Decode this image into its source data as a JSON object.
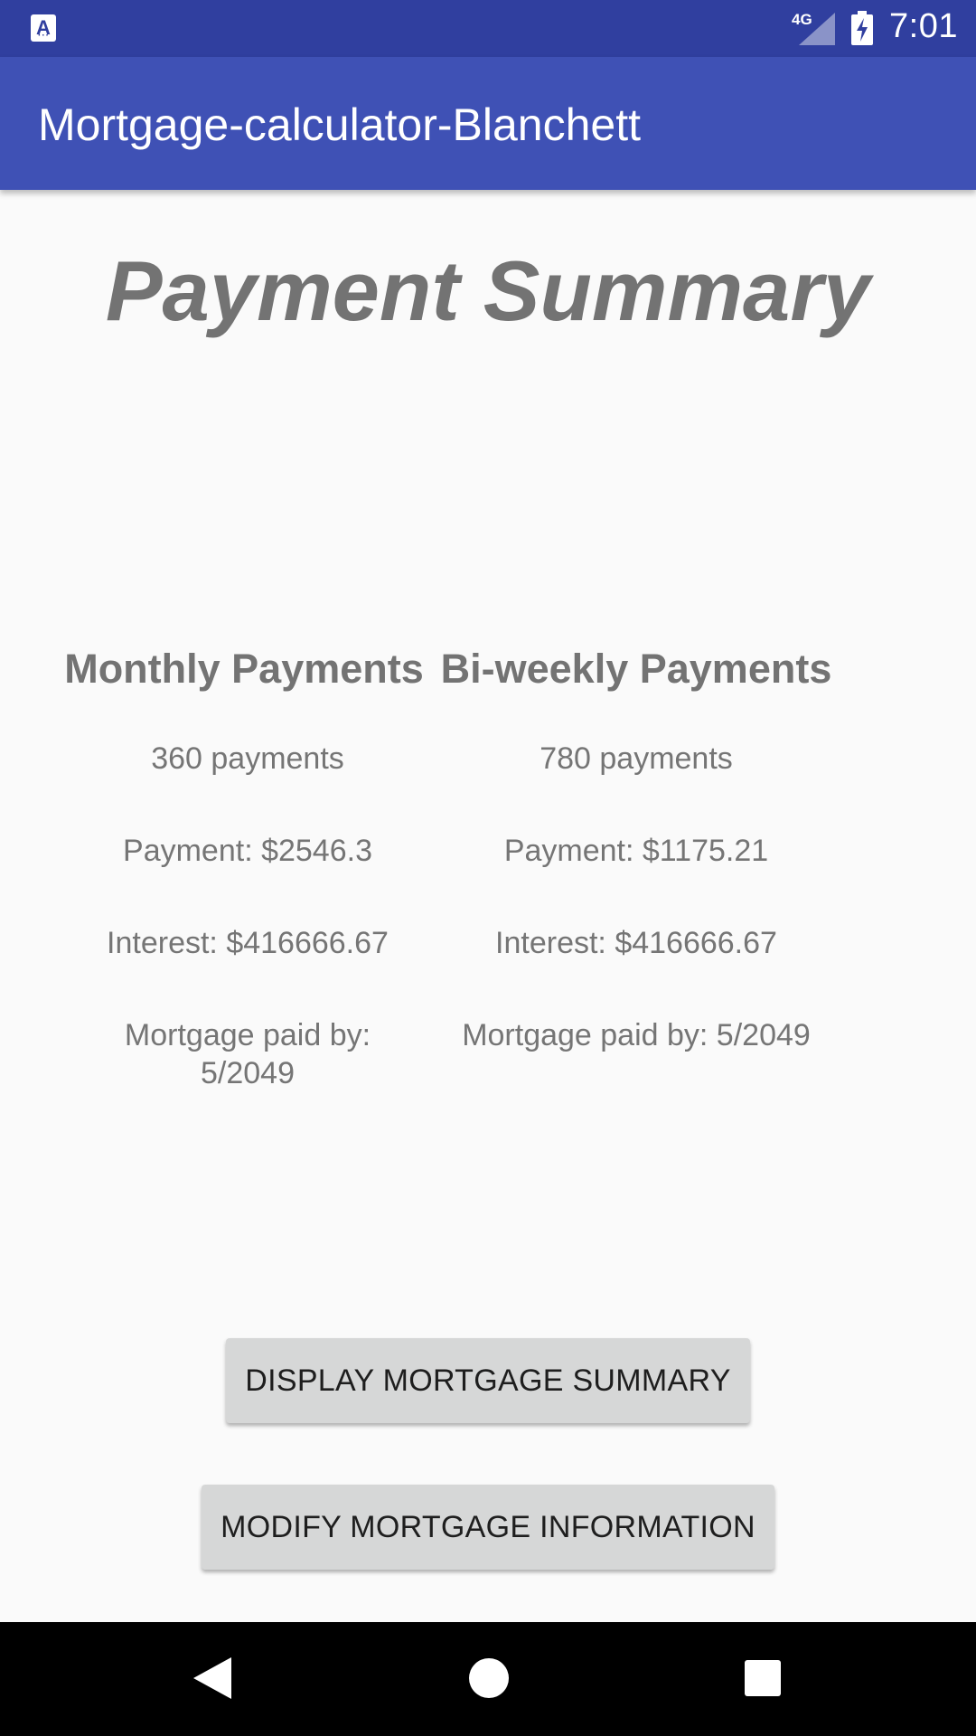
{
  "status_bar": {
    "app_icon": "a-notification-icon",
    "network_label": "4G",
    "signal_icon": "cell-signal-icon",
    "battery_icon": "battery-charging-icon",
    "time": "7:01"
  },
  "app_bar": {
    "title": "Mortgage-calculator-Blanchett"
  },
  "main": {
    "heading": "Payment Summary",
    "monthly": {
      "title": "Monthly Payments",
      "count": "360 payments",
      "payment": "Payment: $2546.3",
      "interest": "Interest: $416666.67",
      "paid_by": "Mortgage paid by: 5/2049"
    },
    "biweekly": {
      "title": "Bi-weekly Payments",
      "count": "780 payments",
      "payment": "Payment: $1175.21",
      "interest": "Interest: $416666.67",
      "paid_by": "Mortgage paid by: 5/2049"
    }
  },
  "buttons": {
    "display_summary": "DISPLAY MORTGAGE SUMMARY",
    "modify_info": "MODIFY MORTGAGE INFORMATION"
  },
  "nav_bar": {
    "back_icon": "back-icon",
    "home_icon": "home-icon",
    "recents_icon": "recents-icon"
  },
  "colors": {
    "status_bar": "#303f9f",
    "app_bar": "#3f51b5",
    "background": "#fafafa",
    "button": "#d6d7d7",
    "text_gray": "#757575"
  }
}
